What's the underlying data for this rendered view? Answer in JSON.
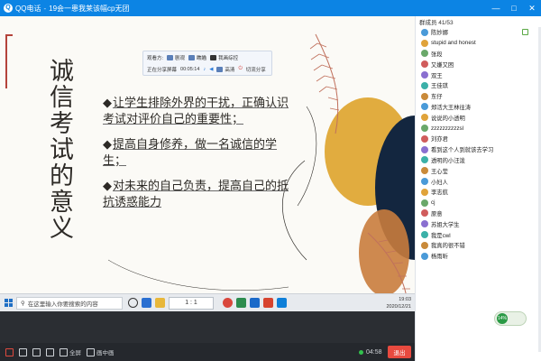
{
  "titlebar": {
    "app_name": "QQ电话",
    "separator": "-",
    "group_name": "19会一患我莱该幅cp无团",
    "minimize": "—",
    "maximize": "□",
    "close": "✕"
  },
  "meeting_toolbar": {
    "label_viewers": "观看方:",
    "viewer_a": "剧观",
    "viewer_b": "瞧瞄",
    "viewer_c": "我画综控",
    "sharing_label": "正在分享屏幕",
    "sharing_time": "00:05:14",
    "hd_label": "高清",
    "stop_label": "切流分享"
  },
  "slide": {
    "vertical_title": "诚信考试的意义",
    "bullet_symbol": "◆",
    "bullets": [
      "让学生排除外界的干扰，正确认识考试对评价自己的重要性；",
      "提高自身修养，做一名诚信的学生；",
      "对未来的自己负责，提高自己的抵抗诱惑能力"
    ]
  },
  "taskbar": {
    "search_placeholder": "在这里输入你要搜索的内容",
    "ratio_label": "1 : 1",
    "time": "19:03",
    "date": "2020/12/21"
  },
  "controlbar": {
    "fullscreen_label": "全屏",
    "gallery_label": "画中画",
    "clock": "04:58",
    "exit_label": "退出"
  },
  "panel": {
    "header": "群成员 41/53",
    "members": [
      "陈妙娜",
      "stupid and honest",
      "张段",
      "又嫌又困",
      "双王",
      "王佳琪",
      "东仔",
      "郑活大王林往涛",
      "说说的小透明",
      "zzzzzzzzzzsl",
      "刘亦君",
      "看到这个人到就该去学习",
      "透明的小汪泼",
      "王心莹",
      "小妇人",
      "李志航",
      "cj",
      "原意",
      "苏姐大学生",
      "我是cwl",
      "我真的很不错",
      "杨雨昕"
    ]
  },
  "float_widget": {
    "label": "14%"
  }
}
